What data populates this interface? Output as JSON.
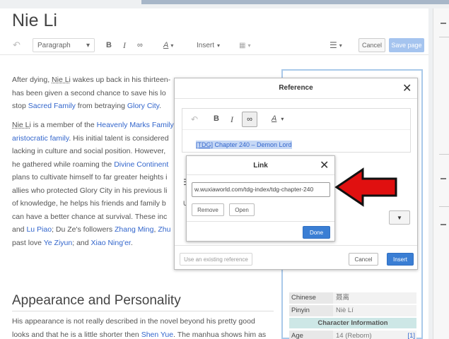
{
  "page": {
    "title": "Nie Li"
  },
  "toolbar": {
    "undo_icon": "undo-icon",
    "format_dropdown": "Paragraph",
    "bold": "B",
    "italic": "I",
    "link_glyph": "∞",
    "text_style": "A",
    "insert": "Insert",
    "cancel": "Cancel",
    "save": "Save page"
  },
  "article": {
    "p1": [
      "After dying, ",
      "Nie Li",
      " wakes up back in his thirteen-",
      "",
      "has been given a second chance to save his lo",
      "stop ",
      "Sacred Family",
      " from betraying ",
      "Glory City",
      "."
    ],
    "p2_l1": [
      "Nie Li",
      " is a member of the ",
      "Heavenly Marks Family"
    ],
    "p2_l2": [
      "aristocratic family",
      ". His initial talent is considered"
    ],
    "p2_l3": "lacking in culture and social position. However,",
    "p2_l4": [
      "he gathered while roaming the ",
      "Divine Continent"
    ],
    "p2_l5": "plans to cultivate himself to far greater heights i",
    "p2_l6": "allies who protected Glory City in his previous li",
    "p2_l7": "of knowledge, he helps his friends and family b",
    "p2_l8": "can have a better chance at survival. These inc",
    "p2_l9": [
      "and ",
      "Lu Piao",
      "; Du Ze's followers ",
      "Zhang Ming",
      ", ",
      "Zhu"
    ],
    "p2_l10": [
      "past love ",
      "Ye Ziyun",
      "; and ",
      "Xiao Ning'er",
      "."
    ],
    "heading": "Appearance and Personality",
    "p3_l1": "His appearance is not really described in the novel beyond his pretty good",
    "p3_l2": [
      "looks and that he is a little shorter then ",
      "Shen Yue",
      ". The manhua shows him as"
    ]
  },
  "infobox": {
    "rows": [
      {
        "key": "Chinese",
        "value": "聂离"
      },
      {
        "key": "Pinyin",
        "value": "Niè Lí"
      }
    ],
    "section": "Character Information",
    "age_key": "Age",
    "age_value": "14 (Reborn)",
    "age_ref": "[1]"
  },
  "reference_dialog": {
    "title": "Reference",
    "bold": "B",
    "italic": "I",
    "link_glyph": "∞",
    "text_style": "A",
    "ref_tag": "[TDG]",
    "ref_text": " Chapter 240 – Demon Lord",
    "use_existing": "Use an existing reference",
    "cancel": "Cancel",
    "insert": "Insert"
  },
  "link_popup": {
    "title": "Link",
    "url": "w.wuxiaworld.com/tdg-index/tdg-chapter-240",
    "remove": "Remove",
    "open": "Open",
    "done": "Done"
  },
  "colors": {
    "link": "#3366cc",
    "primary_button": "#3a7ed4",
    "annotation_arrow": "#e01010"
  }
}
